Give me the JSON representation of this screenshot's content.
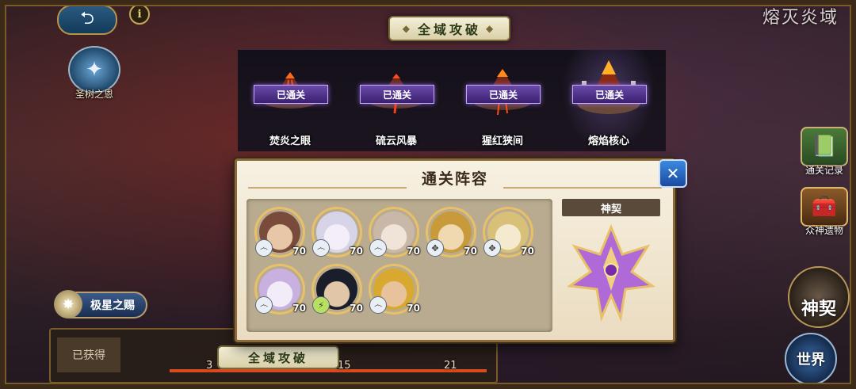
{
  "header": {
    "zone_title": "熔灭炎域",
    "back_label": "⮌",
    "info_label": "i"
  },
  "side": {
    "emblem_label": "圣树之恩"
  },
  "banner_top": "全域攻破",
  "stages": [
    {
      "name": "焚炎之眼",
      "status": "已通关",
      "active": false
    },
    {
      "name": "硫云风暴",
      "status": "已通关",
      "active": false
    },
    {
      "name": "猩红狭间",
      "status": "已通关",
      "active": false
    },
    {
      "name": "熔焰核心",
      "status": "已通关",
      "active": true
    }
  ],
  "right_menu": {
    "records_label": "通关记录",
    "relics_label": "众神遗物",
    "contract_label": "神契",
    "world_label": "世界"
  },
  "star_button": "极星之赐",
  "bottom": {
    "obtained_label": "已获得",
    "banner": "全域攻破",
    "milestones": [
      "3",
      "15",
      "21"
    ]
  },
  "modal": {
    "title": "通关阵容",
    "close_label": "✕",
    "contract_label": "神契",
    "heroes": [
      {
        "level": "70",
        "element": "wind",
        "palette": [
          "#7a4a3a",
          "#e8c7a8"
        ]
      },
      {
        "level": "70",
        "element": "wind",
        "palette": [
          "#d8d4e8",
          "#f4eef8"
        ]
      },
      {
        "level": "70",
        "element": "wind",
        "palette": [
          "#c9b8a8",
          "#f0e4d8"
        ]
      },
      {
        "level": "70",
        "element": "light",
        "palette": [
          "#c99a3a",
          "#f0d8b0"
        ]
      },
      {
        "level": "70",
        "element": "light",
        "palette": [
          "#d8c078",
          "#f4ead0"
        ]
      },
      {
        "level": "70",
        "element": "wind",
        "palette": [
          "#c8b0e0",
          "#f2ecf8"
        ]
      },
      {
        "level": "70",
        "element": "thunder",
        "palette": [
          "#1a1e2a",
          "#e2c6a8"
        ]
      },
      {
        "level": "70",
        "element": "wind",
        "palette": [
          "#d8a830",
          "#e8c29a"
        ]
      }
    ]
  }
}
